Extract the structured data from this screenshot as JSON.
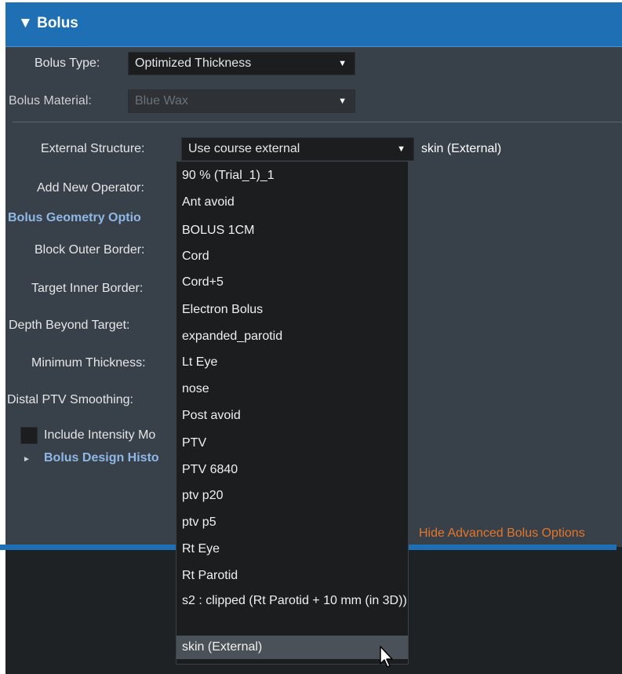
{
  "panel": {
    "title": "Bolus",
    "collapse_icon": "triangle-down-icon"
  },
  "bolus_type": {
    "label": "Bolus Type:",
    "value": "Optimized Thickness"
  },
  "bolus_material": {
    "label": "Bolus Material:",
    "value": "Blue Wax"
  },
  "external_structure": {
    "label": "External Structure:",
    "value": "Use course external",
    "resolved": "skin (External)"
  },
  "add_new_operator": {
    "label": "Add New Operator:"
  },
  "geometry_section": {
    "label": "Bolus Geometry Optio"
  },
  "fields": {
    "block_outer_border": "Block Outer Border:",
    "target_inner_border": "Target Inner Border:",
    "depth_beyond_target": "Depth Beyond Target:",
    "minimum_thickness": "Minimum Thickness:",
    "distal_ptv_smoothing": "Distal PTV Smoothing:"
  },
  "include_intensity": {
    "label": "Include Intensity Mo",
    "checked": false
  },
  "design_history": {
    "label": "Bolus Design Histo"
  },
  "hide_advanced": "Hide Advanced Bolus Options",
  "dropdown": {
    "items": [
      "90 % (Trial_1)_1",
      "Ant avoid",
      "BOLUS 1CM",
      "Cord",
      "Cord+5",
      "Electron Bolus",
      "expanded_parotid",
      "Lt Eye",
      "nose",
      "Post avoid",
      "PTV",
      "PTV 6840",
      "ptv p20",
      "ptv p5",
      "Rt Eye",
      "Rt Parotid",
      "s2 : clipped (Rt Parotid + 10 mm (in 3D))",
      "skin (External)"
    ],
    "highlighted": "skin (External)"
  },
  "colors": {
    "header_blue": "#1e6fb4",
    "panel_bg": "#38404a",
    "link_blue": "#8fb8e6",
    "link_orange": "#e2762b"
  }
}
